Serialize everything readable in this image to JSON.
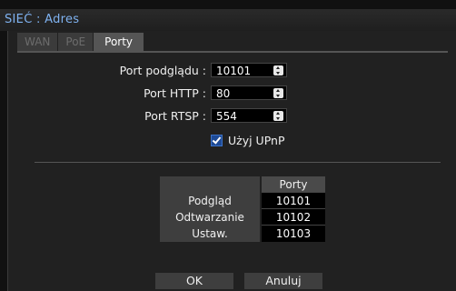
{
  "window": {
    "title": "SIEĆ : Adres"
  },
  "tabs": [
    {
      "label": "WAN",
      "active": false
    },
    {
      "label": "PoE",
      "active": false
    },
    {
      "label": "Porty",
      "active": true
    }
  ],
  "form": {
    "preview_port": {
      "label": "Port podglądu :",
      "value": "10101"
    },
    "http_port": {
      "label": "Port HTTP :",
      "value": "80"
    },
    "rtsp_port": {
      "label": "Port RTSP :",
      "value": "554"
    },
    "upnp": {
      "label": "Użyj UPnP",
      "checked": true
    }
  },
  "ports_table": {
    "header": "Porty",
    "rows": [
      {
        "name": "Podgląd",
        "value": "10101"
      },
      {
        "name": "Odtwarzanie",
        "value": "10102"
      },
      {
        "name": "Ustaw.",
        "value": "10103"
      }
    ]
  },
  "buttons": {
    "ok": "OK",
    "cancel": "Anuluj"
  },
  "colors": {
    "title": "#7fb2f0",
    "checkbox": "#1d4a96"
  }
}
